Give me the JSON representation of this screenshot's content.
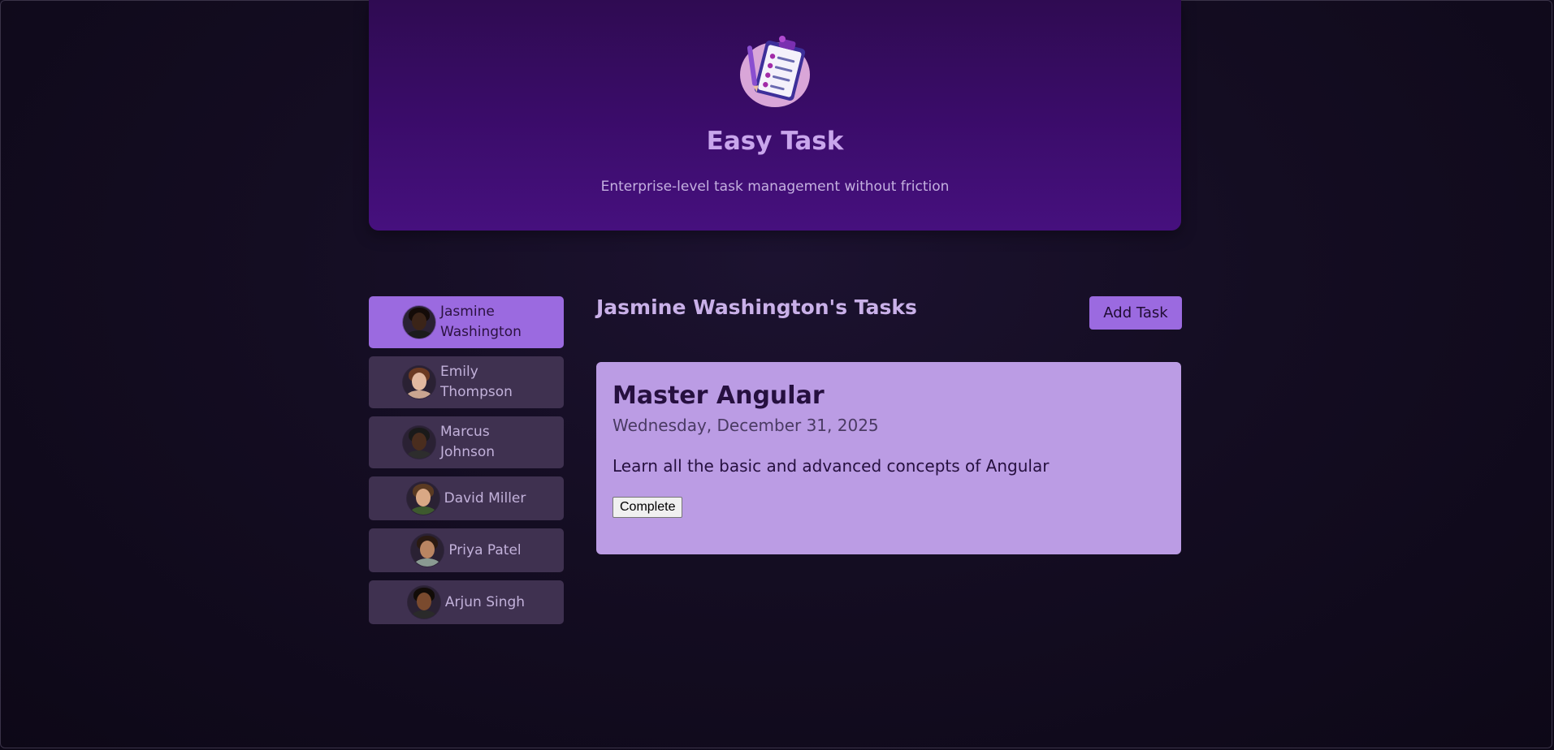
{
  "header": {
    "title": "Easy Task",
    "subtitle": "Enterprise-level task management without friction",
    "logo_icon": "clipboard-checklist-icon"
  },
  "users": [
    {
      "name": "Jasmine Washington",
      "selected": true,
      "skin": "#3b2418",
      "hair": "#140b08",
      "shirt": "#1b1b1b"
    },
    {
      "name": "Emily Thompson",
      "selected": false,
      "skin": "#e2b9a0",
      "hair": "#6b3a22",
      "shirt": "#c9a590"
    },
    {
      "name": "Marcus Johnson",
      "selected": false,
      "skin": "#4a2d1e",
      "hair": "#1a1a1a",
      "shirt": "#2d2d2d"
    },
    {
      "name": "David Miller",
      "selected": false,
      "skin": "#d9a885",
      "hair": "#5a3a22",
      "shirt": "#3e5a2e"
    },
    {
      "name": "Priya Patel",
      "selected": false,
      "skin": "#b98562",
      "hair": "#2a1a12",
      "shirt": "#8a9a92"
    },
    {
      "name": "Arjun Singh",
      "selected": false,
      "skin": "#7a4a2e",
      "hair": "#120c08",
      "shirt": "#2a2a2a"
    }
  ],
  "tasks_panel": {
    "title": "Jasmine Washington's Tasks",
    "add_label": "Add Task"
  },
  "task": {
    "title": "Master Angular",
    "date": "Wednesday, December 31, 2025",
    "description": "Learn all the basic and advanced concepts of Angular",
    "complete_label": "Complete"
  },
  "colors": {
    "accent": "#9b6ae0",
    "card": "#bb9ce4",
    "header_top": "#2f0b52",
    "header_bottom": "#46107e",
    "user_bg": "#3f3150"
  }
}
